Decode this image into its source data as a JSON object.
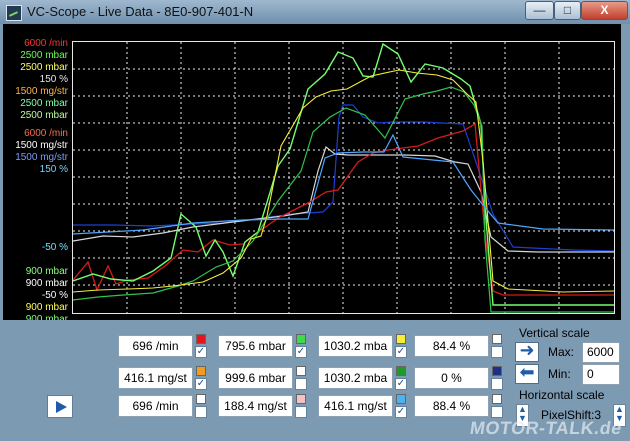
{
  "window": {
    "title": "VC-Scope  -  Live Data  -  8E0-907-401-N",
    "buttons": {
      "minimize": "—",
      "maximize": "□",
      "close": "X"
    }
  },
  "scope": {
    "labels": [
      {
        "text": "6000 /min",
        "color": "#ff3333"
      },
      {
        "text": "2500 mbar",
        "color": "#66ff55"
      },
      {
        "text": "2500 mbar",
        "color": "#ffff66"
      },
      {
        "text": "150 %",
        "color": "#e6e6e6"
      },
      {
        "text": "1500 mg/str",
        "color": "#ffb347"
      },
      {
        "text": "2500 mbar",
        "color": "#7dffa7"
      },
      {
        "text": "2500 mbar",
        "color": "#b8ff9c"
      },
      {
        "text": "6000 /min",
        "color": "#ff6b4d"
      },
      {
        "text": "1500 mg/str",
        "color": "#ffffff"
      },
      {
        "text": "1500 mg/str",
        "color": "#7a9cff"
      },
      {
        "text": "150 %",
        "color": "#7ad0ff"
      },
      {
        "text": "-50 %",
        "color": "#6fe0ff"
      },
      {
        "text": "900 mbar",
        "color": "#8bff7a"
      },
      {
        "text": "900 mbar",
        "color": "#ffffff"
      },
      {
        "text": "-50 %",
        "color": "#ffffff"
      },
      {
        "text": "900 mbar",
        "color": "#ffff5a"
      },
      {
        "text": "900 mbar",
        "color": "#7dff7d"
      }
    ]
  },
  "readouts": [
    {
      "value": "696 /min",
      "color": "#e8141c",
      "checked": true
    },
    {
      "value": "795.6 mbar",
      "color": "#41d84f",
      "checked": true
    },
    {
      "value": "1030.2 mba",
      "color": "#f6ee38",
      "checked": true
    },
    {
      "value": "84.4 %",
      "color": "#ffffff",
      "checked": false
    },
    {
      "value": "416.1 mg/st",
      "color": "#f39b20",
      "checked": true
    },
    {
      "value": "999.6 mbar",
      "color": "#ffffff",
      "checked": false
    },
    {
      "value": "1030.2 mba",
      "color": "#1e9b28",
      "checked": true
    },
    {
      "value": "0 %",
      "color": "#1f2f83",
      "checked": false
    },
    {
      "value": "696 /min",
      "color": "#ffffff",
      "checked": false
    },
    {
      "value": "188.4 mg/st",
      "color": "#f4c1c7",
      "checked": false
    },
    {
      "value": "416.1 mg/st",
      "color": "#4bb3f0",
      "checked": true
    },
    {
      "value": "88.4 %",
      "color": "#ffffff",
      "checked": false
    }
  ],
  "vertical_scale": {
    "title": "Vertical scale",
    "max_label": "Max:",
    "max_value": "6000",
    "min_label": "Min:",
    "min_value": "0"
  },
  "horizontal_scale": {
    "title": "Horizontal scale",
    "pixelshift": "PixelShift:3"
  },
  "watermark": "MOTOR-TALK.de",
  "icons": {
    "play": "play-icon",
    "right_arrow": "right-arrow-icon",
    "left_arrow": "left-arrow-icon",
    "spinner": "spinner-icon"
  }
}
